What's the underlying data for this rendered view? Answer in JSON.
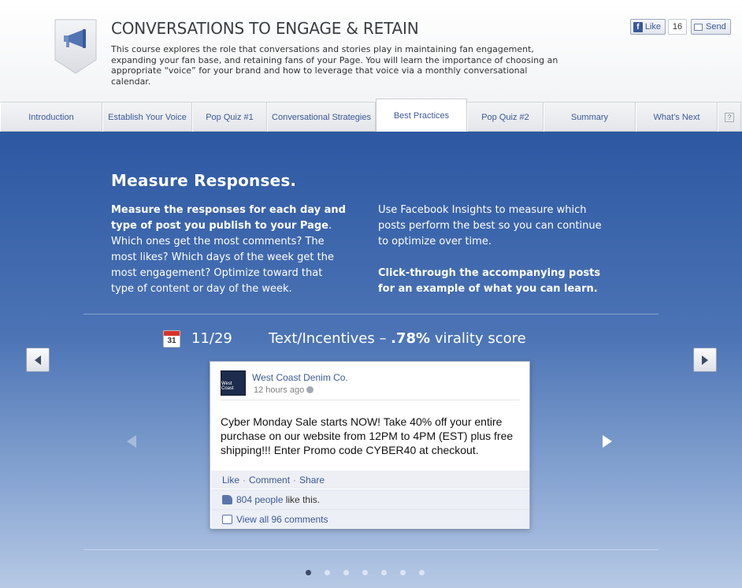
{
  "header": {
    "title": "CONVERSATIONS TO ENGAGE & RETAIN",
    "description": "This course explores the role that conversations and stories play in maintaining fan engagement, expanding your fan base, and retaining fans of your Page. You will learn the importance of choosing an appropriate “voice” for your brand and how to leverage that voice via a monthly conversational calendar.",
    "badge_icon": "megaphone-icon",
    "like_label": "Like",
    "like_count": "16",
    "send_label": "Send"
  },
  "tabs": [
    {
      "label": "Introduction",
      "active": false
    },
    {
      "label": "Establish Your Voice",
      "active": false
    },
    {
      "label": "Pop Quiz #1",
      "active": false
    },
    {
      "label": "Conversational Strategies",
      "active": false
    },
    {
      "label": "Best Practices",
      "active": true
    },
    {
      "label": "Pop Quiz #2",
      "active": false
    },
    {
      "label": "Summary",
      "active": false
    },
    {
      "label": "What's Next",
      "active": false
    }
  ],
  "help_label": "?",
  "content": {
    "title": "Measure Responses.",
    "left_bold": "Measure the responses for each day and type of post you publish to your Page",
    "left_rest": ". Which ones get the most comments? The most likes? Which days of the week get the most engagement? Optimize toward that type of content or day of the week.",
    "right_p1": "Use Facebook Insights to measure which posts perform the best so you can continue to optimize over time.",
    "right_p2": "Click-through the accompanying posts for an example of what you can learn."
  },
  "example": {
    "calendar_day": "31",
    "date": "11/29",
    "type_prefix": "Text/Incentives – ",
    "score": ".78%",
    "type_suffix": " virality score"
  },
  "post": {
    "page_name": "West Coast Denim Co.",
    "avatar_text": "West Coast",
    "time": "12 hours ago",
    "body": "Cyber Monday Sale starts NOW! Take 40% off your entire purchase on our website from 12PM to 4PM (EST) plus free shipping!!! Enter Promo code CYBER40 at checkout.",
    "action_like": "Like",
    "action_comment": "Comment",
    "action_share": "Share",
    "action_sep": "·",
    "likes_count": "804 people",
    "likes_suffix": " like this.",
    "comments_label": "View all 96 comments"
  },
  "pagination": {
    "total": 7,
    "active": 1
  }
}
